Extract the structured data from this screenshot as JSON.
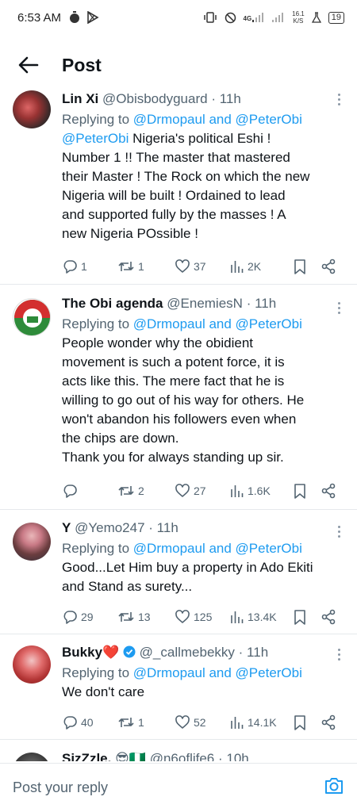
{
  "status_bar": {
    "time": "6:53 AM",
    "net_speed_top": "16.1",
    "net_speed_bottom": "K/S",
    "battery": "19",
    "signal": "4G"
  },
  "header": {
    "title": "Post"
  },
  "tweets": [
    {
      "name": "Lin Xi",
      "handle": "@Obisbodyguard",
      "time": "· 11h",
      "reply_prefix": "Replying to ",
      "reply_targets": "@Drmopaul and @PeterObi",
      "text_lines": [
        "@PeterObi Nigeria's political Eshi !",
        "Number 1 !! The master that mastered",
        "their Master ! The Rock on which the new",
        "Nigeria will be built ! Ordained to lead",
        "and supported fully by the masses ! A",
        "new Nigeria POssible !"
      ],
      "first_mention": "@PeterObi",
      "replies": "1",
      "retweets": "1",
      "likes": "37",
      "views": "2K"
    },
    {
      "name": "The Obi agenda",
      "handle": "@EnemiesN",
      "time": "· 11h",
      "reply_prefix": "Replying to ",
      "reply_targets": "@Drmopaul and @PeterObi",
      "text_lines": [
        "People wonder why the obidient",
        "movement is such a potent force, it is",
        "acts like this. The mere fact that he is",
        "willing to go out of his way for others. He",
        "won't abandon his followers even when",
        "the chips are down.",
        "Thank you for always standing up sir."
      ],
      "replies": "",
      "retweets": "2",
      "likes": "27",
      "views": "1.6K"
    },
    {
      "name": "Y",
      "handle": "@Yemo247",
      "time": "· 11h",
      "reply_prefix": "Replying to ",
      "reply_targets": "@Drmopaul and @PeterObi",
      "text_lines": [
        "Good...Let Him buy a property in Ado Ekiti",
        "and Stand as surety..."
      ],
      "replies": "29",
      "retweets": "13",
      "likes": "125",
      "views": "13.4K"
    },
    {
      "name": "Bukky",
      "heart_emoji": "❤️",
      "handle": "@_callmebekky",
      "time": "· 11h",
      "reply_prefix": "Replying to ",
      "reply_targets": "@Drmopaul and @PeterObi",
      "text_lines": [
        "We don't care"
      ],
      "replies": "40",
      "retweets": "1",
      "likes": "52",
      "views": "14.1K"
    },
    {
      "name": "SizZzle.",
      "emojis": "😎🇳🇬",
      "handle": "@n6oflife6",
      "time": "· 10h"
    }
  ],
  "reply_bar": {
    "placeholder": "Post your reply"
  },
  "colors": {
    "accent": "#1d9bf0",
    "text": "#0f1419",
    "secondary": "#536471",
    "divider": "#e6e9ec"
  },
  "icons": [
    "back-arrow-icon",
    "reply-icon",
    "retweet-icon",
    "like-icon",
    "views-icon",
    "bookmark-icon",
    "share-icon",
    "more-icon",
    "camera-icon",
    "verified-badge-icon"
  ]
}
